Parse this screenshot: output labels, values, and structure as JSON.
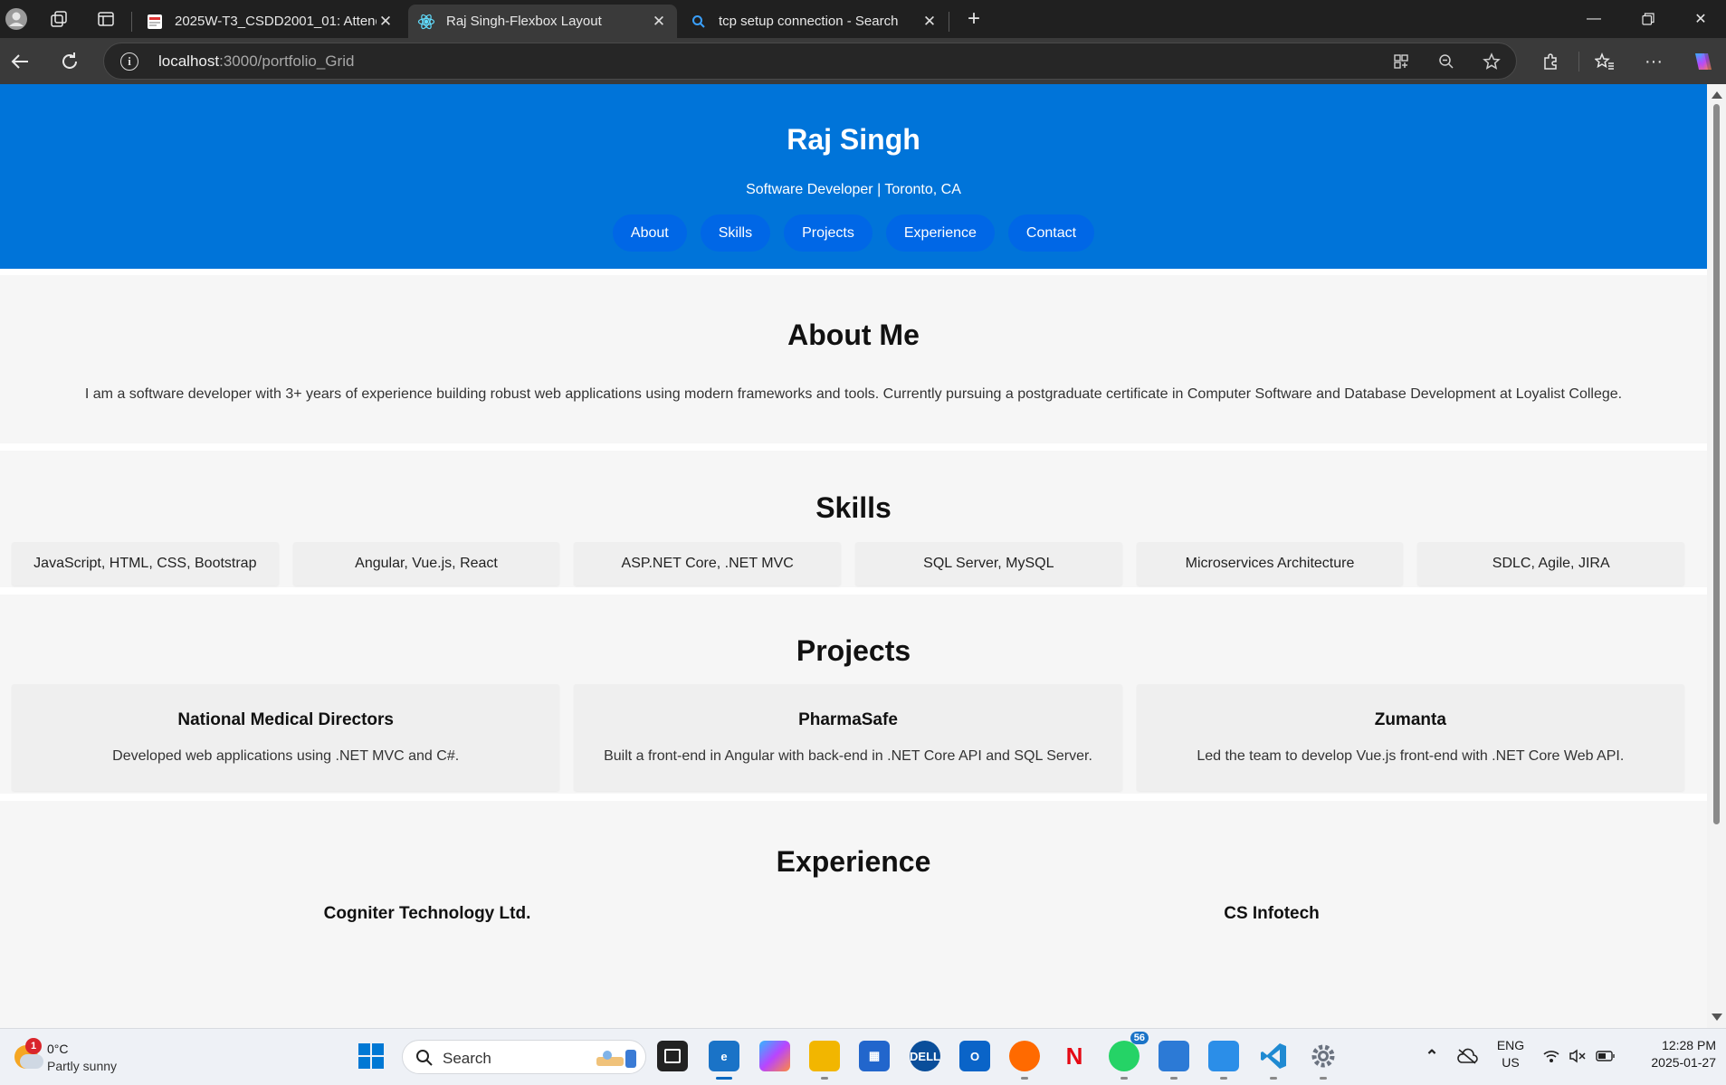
{
  "browser": {
    "tabs": [
      {
        "title": "2025W-T3_CSDD2001_01: Attend",
        "favicon": "document-icon",
        "active": false
      },
      {
        "title": "Raj Singh-Flexbox Layout",
        "favicon": "react-icon",
        "active": true
      },
      {
        "title": "tcp setup connection - Search",
        "favicon": "search-icon",
        "active": false
      }
    ],
    "url_host": "localhost",
    "url_path": ":3000/portfolio_Grid"
  },
  "page": {
    "name": "Raj Singh",
    "subtitle": "Software Developer | Toronto, CA",
    "nav": [
      "About",
      "Skills",
      "Projects",
      "Experience",
      "Contact"
    ],
    "about": {
      "heading": "About Me",
      "text": "I am a software developer with 3+ years of experience building robust web applications using modern frameworks and tools. Currently pursuing a postgraduate certificate in Computer Software and Database Development at Loyalist College."
    },
    "skills": {
      "heading": "Skills",
      "items": [
        "JavaScript, HTML, CSS, Bootstrap",
        "Angular, Vue.js, React",
        "ASP.NET Core, .NET MVC",
        "SQL Server, MySQL",
        "Microservices Architecture",
        "SDLC, Agile, JIRA"
      ]
    },
    "projects": {
      "heading": "Projects",
      "items": [
        {
          "title": "National Medical Directors",
          "desc": "Developed web applications using .NET MVC and C#."
        },
        {
          "title": "PharmaSafe",
          "desc": "Built a front-end in Angular with back-end in .NET Core API and SQL Server."
        },
        {
          "title": "Zumanta",
          "desc": "Led the team to develop Vue.js front-end with .NET Core Web API."
        }
      ]
    },
    "experience": {
      "heading": "Experience",
      "items": [
        "Cogniter Technology Ltd.",
        "CS Infotech"
      ]
    }
  },
  "taskbar": {
    "weather_temp": "0°C",
    "weather_cond": "Partly sunny",
    "weather_badge": "1",
    "search_label": "Search",
    "whatsapp_badge": "56",
    "lang": "ENG",
    "region": "US",
    "time": "12:28 PM",
    "date": "2025-01-27"
  },
  "colors": {
    "hero": "#0074d9",
    "nav_pill": "#0067e6",
    "section_bg": "#f6f6f6",
    "card_bg": "#efefef"
  }
}
